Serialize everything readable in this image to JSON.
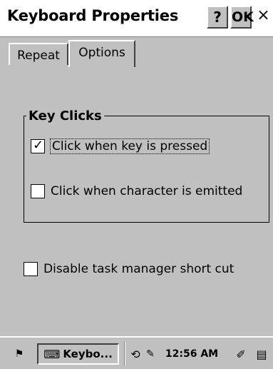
{
  "window": {
    "title": "Keyboard Properties",
    "help_label": "?",
    "ok_label": "OK",
    "close_label": "×"
  },
  "tabs": [
    {
      "label": "Repeat",
      "selected": false
    },
    {
      "label": "Options",
      "selected": true
    }
  ],
  "group": {
    "label": "Key Clicks"
  },
  "options": [
    {
      "label": "Click when key is pressed",
      "checked": true
    },
    {
      "label": "Click when character is emitted",
      "checked": false
    }
  ],
  "extra_option": {
    "label": "Disable task manager short cut",
    "checked": false
  },
  "taskbar": {
    "task_label": "Keybo...",
    "clock": "12:56 AM",
    "check_mark": "✓",
    "start_icon": "windows-flag-icon",
    "task_icon": "keyboard-icon",
    "tray_icons": [
      "sync-icon",
      "edit-icon",
      "input-panel-icon",
      "desktop-icon"
    ]
  }
}
